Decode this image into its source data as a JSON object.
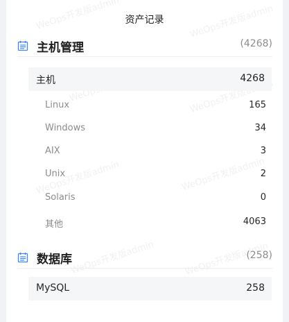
{
  "panel": {
    "title": "资产记录"
  },
  "watermark": {
    "text": "WeOps开发版admin"
  },
  "sections": [
    {
      "title": "主机管理",
      "count": "(4268)",
      "icon": "list-icon",
      "group": {
        "label": "主机",
        "value": "4268"
      },
      "items": [
        {
          "label": "Linux",
          "value": "165"
        },
        {
          "label": "Windows",
          "value": "34"
        },
        {
          "label": "AIX",
          "value": "3"
        },
        {
          "label": "Unix",
          "value": "2"
        },
        {
          "label": "Solaris",
          "value": "0"
        },
        {
          "label": "其他",
          "value": "4063"
        }
      ]
    },
    {
      "title": "数据库",
      "count": "(258)",
      "icon": "list-icon",
      "group": {
        "label": "MySQL",
        "value": "258"
      },
      "items": []
    }
  ],
  "colors": {
    "accent": "#3a84ff",
    "border": "#ebeef2",
    "group_bg": "#f5f6f8"
  }
}
